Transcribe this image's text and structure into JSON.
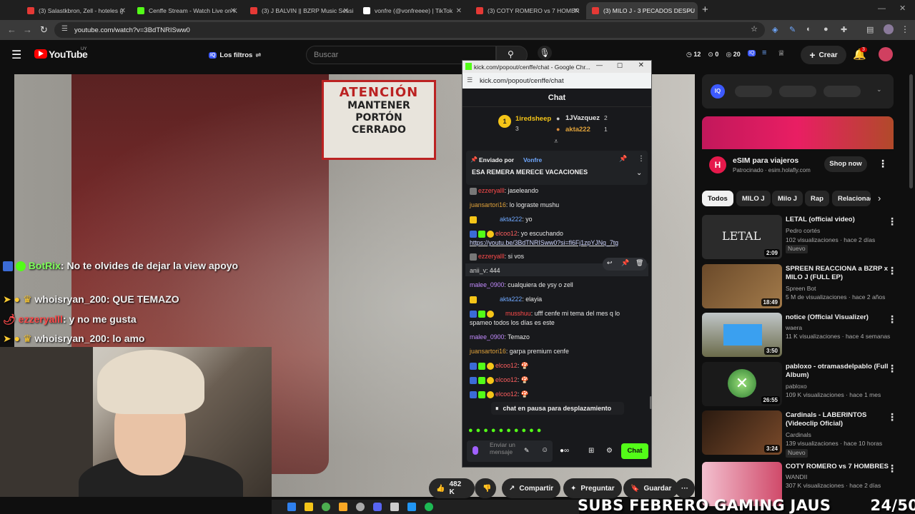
{
  "browser": {
    "tabs": [
      {
        "title": "(3) Salastkbron, Zell - hoteles (j",
        "color": "#e53935"
      },
      {
        "title": "Cenffe Stream - Watch Live on K",
        "color": "#53fc18"
      },
      {
        "title": "(3) J BALVIN || BZRP Music Sessi",
        "color": "#e53935"
      },
      {
        "title": "vonfre (@vonfreeee) | TikTok",
        "color": "#ffffff"
      },
      {
        "title": "(3) COTY ROMERO vs 7 HOMBR",
        "color": "#e53935"
      },
      {
        "title": "(3) MILO J - 3 PECADOS DESPU",
        "color": "#e53935"
      }
    ],
    "url": "youtube.com/watch?v=3BdTNRISww0"
  },
  "youtube": {
    "logo": "YouTube",
    "country": "UY",
    "filters_label": "Los filtros",
    "search_placeholder": "Buscar",
    "stats": [
      "12",
      "0",
      "20"
    ],
    "create_label": "Crear",
    "notif_count": "3"
  },
  "video": {
    "sign_lines": [
      "ATENCIÓN",
      "MANTENER",
      "PORTÓN",
      "CERRADO"
    ],
    "overlay_chat": [
      {
        "user": "BotRix",
        "text": ": No te olvides de dejar la view apoyo",
        "color": "#7fff5a"
      },
      {
        "user": "whoisryan_200",
        "text": ": QUE TEMAZO",
        "color": "#ffffff"
      },
      {
        "user": "ezzeryalll",
        "text": ": y no me gusta",
        "color": "#ff4b4b"
      },
      {
        "user": "whoisryan_200",
        "text": ": lo amo",
        "color": "#ffffff"
      }
    ],
    "subs_text": "SUBS FEBRERO GAMING JAUS",
    "subs_count": "24/50"
  },
  "actions": {
    "likes": "482 K",
    "share": "Compartir",
    "ask": "Preguntar",
    "save": "Guardar"
  },
  "popup": {
    "window_title": "kick.com/popout/cenffe/chat - Google Chr...",
    "url": "kick.com/popout/cenffe/chat",
    "chat_header": "Chat",
    "leaderboard": [
      {
        "name": "1iredsheep",
        "count": "3"
      },
      {
        "name": "1JVazquez",
        "count": "2"
      },
      {
        "name": "akta222",
        "count": "1"
      }
    ],
    "pinned_by_label": "Enviado por",
    "pinned_by_user": "Vonfre",
    "pinned_message": "ESA REMERA MERECE VACACIONES",
    "messages": [
      {
        "user": "ezzeryalll",
        "text": ": jaseleando",
        "color": "#ff4b4b"
      },
      {
        "user": "juansartori16",
        "text": ": lo lograste mushu",
        "color": "#e0a23a"
      },
      {
        "user": "akta222",
        "text": ": yo",
        "color": "#6fa8ff"
      },
      {
        "user": "elcoo12",
        "text": ": yo escuchando",
        "color": "#ff5f5f"
      },
      {
        "user": "",
        "text": "https://youtu.be/3BdTNRISww0?si=fl6Fj1zpYJNq_7tg",
        "color": "#cfd6ff"
      },
      {
        "user": "ezzeryalll",
        "text": ": si vos",
        "color": "#ff4b4b"
      },
      {
        "user": "anii_v",
        "text": ": 444",
        "color": "#cfcfcf"
      },
      {
        "user": "malee_0900",
        "text": ": cualquiera de ysy o zell",
        "color": "#c38bff"
      },
      {
        "user": "akta222",
        "text": ": elayia",
        "color": "#6fa8ff"
      },
      {
        "user": "musshuu",
        "text": ": ufff cenfe mi tema del mes q lo",
        "color": "#ff4b4b"
      },
      {
        "user": "",
        "text": "spameo todos los días es este",
        "color": "#e8e8e8"
      },
      {
        "user": "malee_0900",
        "text": ": Temazo",
        "color": "#c38bff"
      },
      {
        "user": "juansartori16",
        "text": ": garpa premium cenfe",
        "color": "#e0a23a"
      },
      {
        "user": "elcoo12",
        "text": ":",
        "color": "#ff5f5f"
      },
      {
        "user": "elcoo12",
        "text": ":",
        "color": "#ff5f5f"
      },
      {
        "user": "elcoo12",
        "text": ":",
        "color": "#ff5f5f"
      }
    ],
    "paused_label": "chat en pausa para desplazamiento",
    "input_placeholder": "Enviar un mensaje",
    "send_label": "Chat"
  },
  "sidebar": {
    "ad_title": "eSIM para viajeros",
    "ad_sponsor": "Patrocinado · esim.holafly.com",
    "ad_button": "Shop now",
    "chips": [
      "Todos",
      "MILO J",
      "Milo J",
      "Rap",
      "Relacionad"
    ],
    "videos": [
      {
        "title": "LETAL (official video)",
        "channel": "Pedro cortés",
        "meta": "102 visualizaciones · hace 2 días",
        "badge": "Nuevo",
        "duration": "2:09",
        "thumb_color": "#3a3a3a"
      },
      {
        "title": "SPREEN REACCIONA a BZRP x MILO J (FULL EP)",
        "channel": "Spreen Bot",
        "meta": "5 M de visualizaciones · hace 2 años",
        "badge": "",
        "duration": "18:49",
        "thumb_color": "#8a5a3a"
      },
      {
        "title": "notice (Official Visualizer)",
        "channel": "waera",
        "meta": "11 K visualizaciones · hace 4 semanas",
        "badge": "",
        "duration": "3:50",
        "thumb_color": "#6b6b5a"
      },
      {
        "title": "pabloxo - otramasdelpablo (Full Album)",
        "channel": "pabloxo",
        "meta": "109 K visualizaciones · hace 1 mes",
        "badge": "",
        "duration": "26:55",
        "thumb_color": "#1a1a1a"
      },
      {
        "title": "Cardinals - LABERINTOS (Videoclip Oficial)",
        "channel": "Cardinals",
        "meta": "139 visualizaciones · hace 10 horas",
        "badge": "Nuevo",
        "duration": "3:24",
        "thumb_color": "#4a2a1a"
      },
      {
        "title": "COTY ROMERO vs 7 HOMBRES",
        "channel": "WANDII",
        "meta": "307 K visualizaciones · hace 2 días",
        "badge": "",
        "duration": "",
        "thumb_color": "#d88aa0"
      }
    ]
  }
}
